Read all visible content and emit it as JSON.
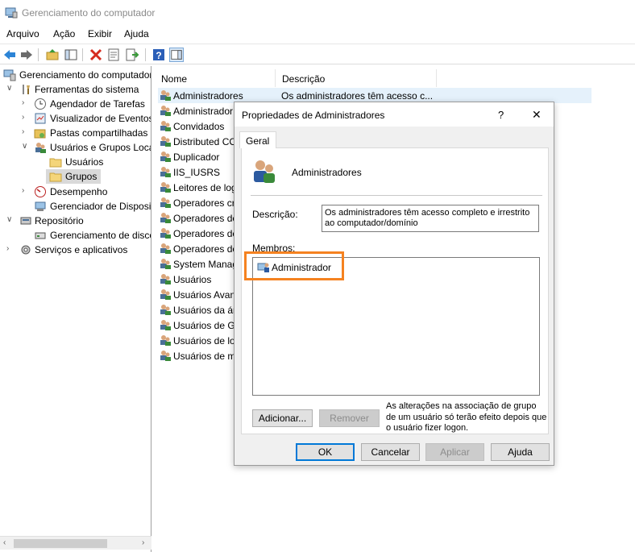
{
  "window": {
    "title": "Gerenciamento do computador"
  },
  "menu": [
    "Arquivo",
    "Ação",
    "Exibir",
    "Ajuda"
  ],
  "toolbar_icons": [
    "back-arrow-icon",
    "forward-arrow-icon",
    "up-folder-icon",
    "show-hide-tree-icon",
    "delete-icon",
    "properties-icon",
    "export-list-icon",
    "help-icon",
    "show-hide-action-pane-icon"
  ],
  "tree": [
    {
      "label": "Gerenciamento do computador",
      "chev": "",
      "icon": "computer-mgmt-icon"
    },
    {
      "label": "Ferramentas do sistema",
      "chev": "∨",
      "icon": "tools-icon"
    },
    {
      "label": "Agendador de Tarefas",
      "chev": "›",
      "icon": "clock-icon"
    },
    {
      "label": "Visualizador de Eventos",
      "chev": "›",
      "icon": "event-viewer-icon"
    },
    {
      "label": "Pastas compartilhadas",
      "chev": "›",
      "icon": "shared-folder-icon"
    },
    {
      "label": "Usuários e Grupos Loca",
      "chev": "∨",
      "icon": "users-groups-icon"
    },
    {
      "label": "Usuários",
      "chev": "",
      "icon": "folder-icon"
    },
    {
      "label": "Grupos",
      "chev": "",
      "icon": "folder-icon"
    },
    {
      "label": "Desempenho",
      "chev": "›",
      "icon": "performance-icon"
    },
    {
      "label": "Gerenciador de Disposit",
      "chev": "",
      "icon": "device-manager-icon"
    },
    {
      "label": "Repositório",
      "chev": "∨",
      "icon": "storage-icon"
    },
    {
      "label": "Gerenciamento de disco",
      "chev": "",
      "icon": "disk-icon"
    },
    {
      "label": "Serviços e aplicativos",
      "chev": "›",
      "icon": "services-icon"
    }
  ],
  "list": {
    "columns": [
      "Nome",
      "Descrição"
    ],
    "rows": [
      {
        "name": "Administradores",
        "desc": "Os administradores têm acesso c..."
      },
      {
        "name": "Administrador",
        "desc": ""
      },
      {
        "name": "Convidados",
        "desc": ""
      },
      {
        "name": "Distributed CO",
        "desc": ""
      },
      {
        "name": "Duplicador",
        "desc": ""
      },
      {
        "name": "IIS_IUSRS",
        "desc": ""
      },
      {
        "name": "Leitores de log",
        "desc": ""
      },
      {
        "name": "Operadores cri",
        "desc": ""
      },
      {
        "name": "Operadores de",
        "desc": ""
      },
      {
        "name": "Operadores de",
        "desc": ""
      },
      {
        "name": "Operadores de",
        "desc": ""
      },
      {
        "name": "System Manag",
        "desc": ""
      },
      {
        "name": "Usuários",
        "desc": ""
      },
      {
        "name": "Usuários Avan",
        "desc": ""
      },
      {
        "name": "Usuários da ár",
        "desc": ""
      },
      {
        "name": "Usuários de Ge",
        "desc": ""
      },
      {
        "name": "Usuários de lo",
        "desc": ""
      },
      {
        "name": "Usuários de m",
        "desc": ""
      }
    ]
  },
  "dialog": {
    "title": "Propriedades de Administradores",
    "help_glyph": "?",
    "close_glyph": "✕",
    "tab": "Geral",
    "group_name": "Administradores",
    "description_label": "Descrição:",
    "description_value": "Os administradores têm acesso completo e irrestrito ao computador/domínio",
    "members_label": "Membros:",
    "members": [
      "Administrador"
    ],
    "add_button": "Adicionar...",
    "remove_button": "Remover",
    "note": "As alterações na associação de grupo de um usuário só terão efeito depois que o usuário fizer logon.",
    "ok": "OK",
    "cancel": "Cancelar",
    "apply": "Aplicar",
    "help": "Ajuda"
  },
  "colors": {
    "highlight": "#f58220",
    "selection": "#e5f1fb"
  }
}
